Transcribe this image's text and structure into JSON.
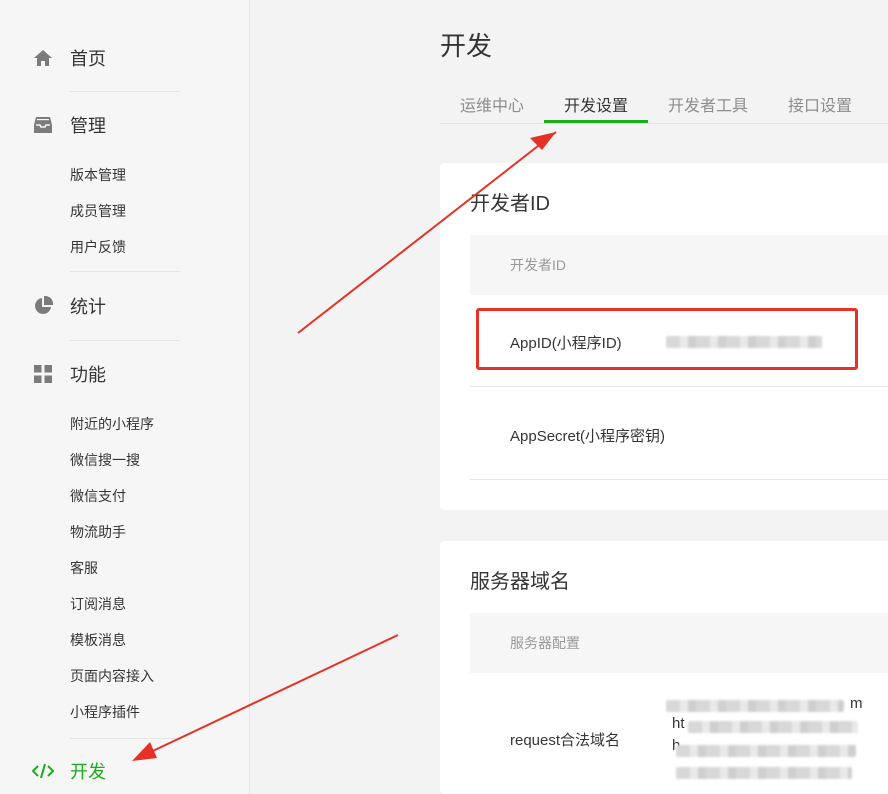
{
  "sidebar": {
    "home": {
      "label": "首页",
      "icon": "home-icon"
    },
    "manage": {
      "label": "管理",
      "icon": "inbox-icon",
      "items": [
        "版本管理",
        "成员管理",
        "用户反馈"
      ]
    },
    "stats": {
      "label": "统计",
      "icon": "pie-chart-icon"
    },
    "features": {
      "label": "功能",
      "icon": "grid-icon",
      "items": [
        "附近的小程序",
        "微信搜一搜",
        "微信支付",
        "物流助手",
        "客服",
        "订阅消息",
        "模板消息",
        "页面内容接入",
        "小程序插件"
      ]
    },
    "dev": {
      "label": "开发",
      "icon": "code-icon",
      "active": true
    }
  },
  "main": {
    "title": "开发",
    "tabs": [
      {
        "label": "运维中心",
        "active": false
      },
      {
        "label": "开发设置",
        "active": true
      },
      {
        "label": "开发者工具",
        "active": false
      },
      {
        "label": "接口设置",
        "active": false
      }
    ],
    "developer_card": {
      "title": "开发者ID",
      "table_header": "开发者ID",
      "rows": [
        {
          "key": "AppID(小程序ID)",
          "value_redacted": true
        },
        {
          "key": "AppSecret(小程序密钥)",
          "value_redacted": false
        }
      ]
    },
    "server_card": {
      "title": "服务器域名",
      "table_header": "服务器配置",
      "rows": [
        {
          "key": "request合法域名",
          "value_fragments": [
            "m",
            "ht",
            "h"
          ]
        }
      ]
    }
  },
  "colors": {
    "accent": "#1aad19",
    "annotation": "#e43227"
  }
}
